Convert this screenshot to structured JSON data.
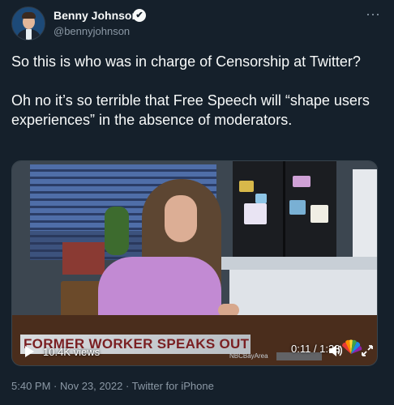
{
  "author": {
    "name": "Benny Johnson",
    "handle": "@bennyjohnson",
    "verified_glyph": "✔",
    "more_glyph": "···"
  },
  "tweet": {
    "paragraphs": [
      "So this is who was in charge of Censorship at Twitter?",
      "Oh no it’s so terrible that Free Speech will “shape users experiences” in the absence of moderators."
    ]
  },
  "video": {
    "banner_text": "FORMER WORKER SPEAKS OUT",
    "views": "10.4K views",
    "time": "0:11 / 1:33",
    "channel_tag": "NBCBayArea",
    "volume_icon": "volume-icon",
    "expand_icon": "expand-icon"
  },
  "footer": {
    "time": "5:40 PM",
    "date": "Nov 23, 2022",
    "source": "Twitter for iPhone"
  }
}
